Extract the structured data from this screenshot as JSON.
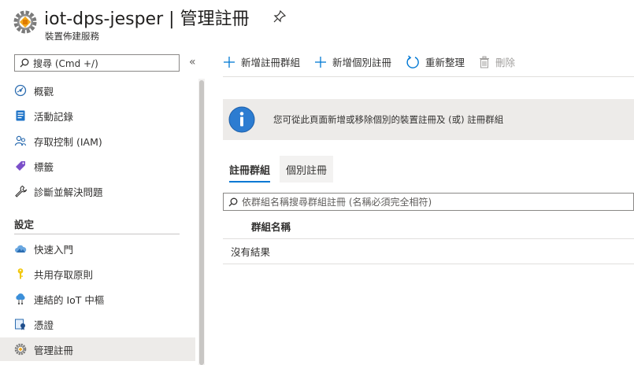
{
  "header": {
    "title": "iot-dps-jesper | 管理註冊",
    "subtitle": "裝置佈建服務",
    "icon": "dps-gear-icon",
    "pin_icon": "pin-icon"
  },
  "sidebar": {
    "search_placeholder": "搜尋 (Cmd +/)",
    "collapse_glyph": "«",
    "items": [
      {
        "label": "概觀",
        "icon": "overview-icon"
      },
      {
        "label": "活動記錄",
        "icon": "activity-log-icon"
      },
      {
        "label": "存取控制 (IAM)",
        "icon": "iam-icon"
      },
      {
        "label": "標籤",
        "icon": "tag-icon"
      },
      {
        "label": "診斷並解決問題",
        "icon": "wrench-icon"
      }
    ],
    "section_title": "設定",
    "settings_items": [
      {
        "label": "快速入門",
        "icon": "cloud-quickstart-icon"
      },
      {
        "label": "共用存取原則",
        "icon": "key-icon"
      },
      {
        "label": "連結的 IoT 中樞",
        "icon": "iot-hub-icon"
      },
      {
        "label": "憑證",
        "icon": "certificate-icon"
      },
      {
        "label": "管理註冊",
        "icon": "gear-icon",
        "selected": true
      }
    ]
  },
  "toolbar": {
    "add_group": "新增註冊群組",
    "add_individual": "新增個別註冊",
    "refresh": "重新整理",
    "delete": "刪除"
  },
  "info": {
    "message": "您可從此頁面新增或移除個別的裝置註冊及 (或) 註冊群組"
  },
  "tabs": [
    {
      "label": "註冊群組",
      "active": true
    },
    {
      "label": "個別註冊",
      "active": false
    }
  ],
  "filter": {
    "placeholder": "依群組名稱搜尋群組註冊 (名稱必須完全相符)"
  },
  "table": {
    "column": "群組名稱",
    "empty": "沒有結果"
  },
  "colors": {
    "accent": "#0078d4",
    "selected_bg": "#edebe9",
    "info_bg": "#edebe9"
  }
}
